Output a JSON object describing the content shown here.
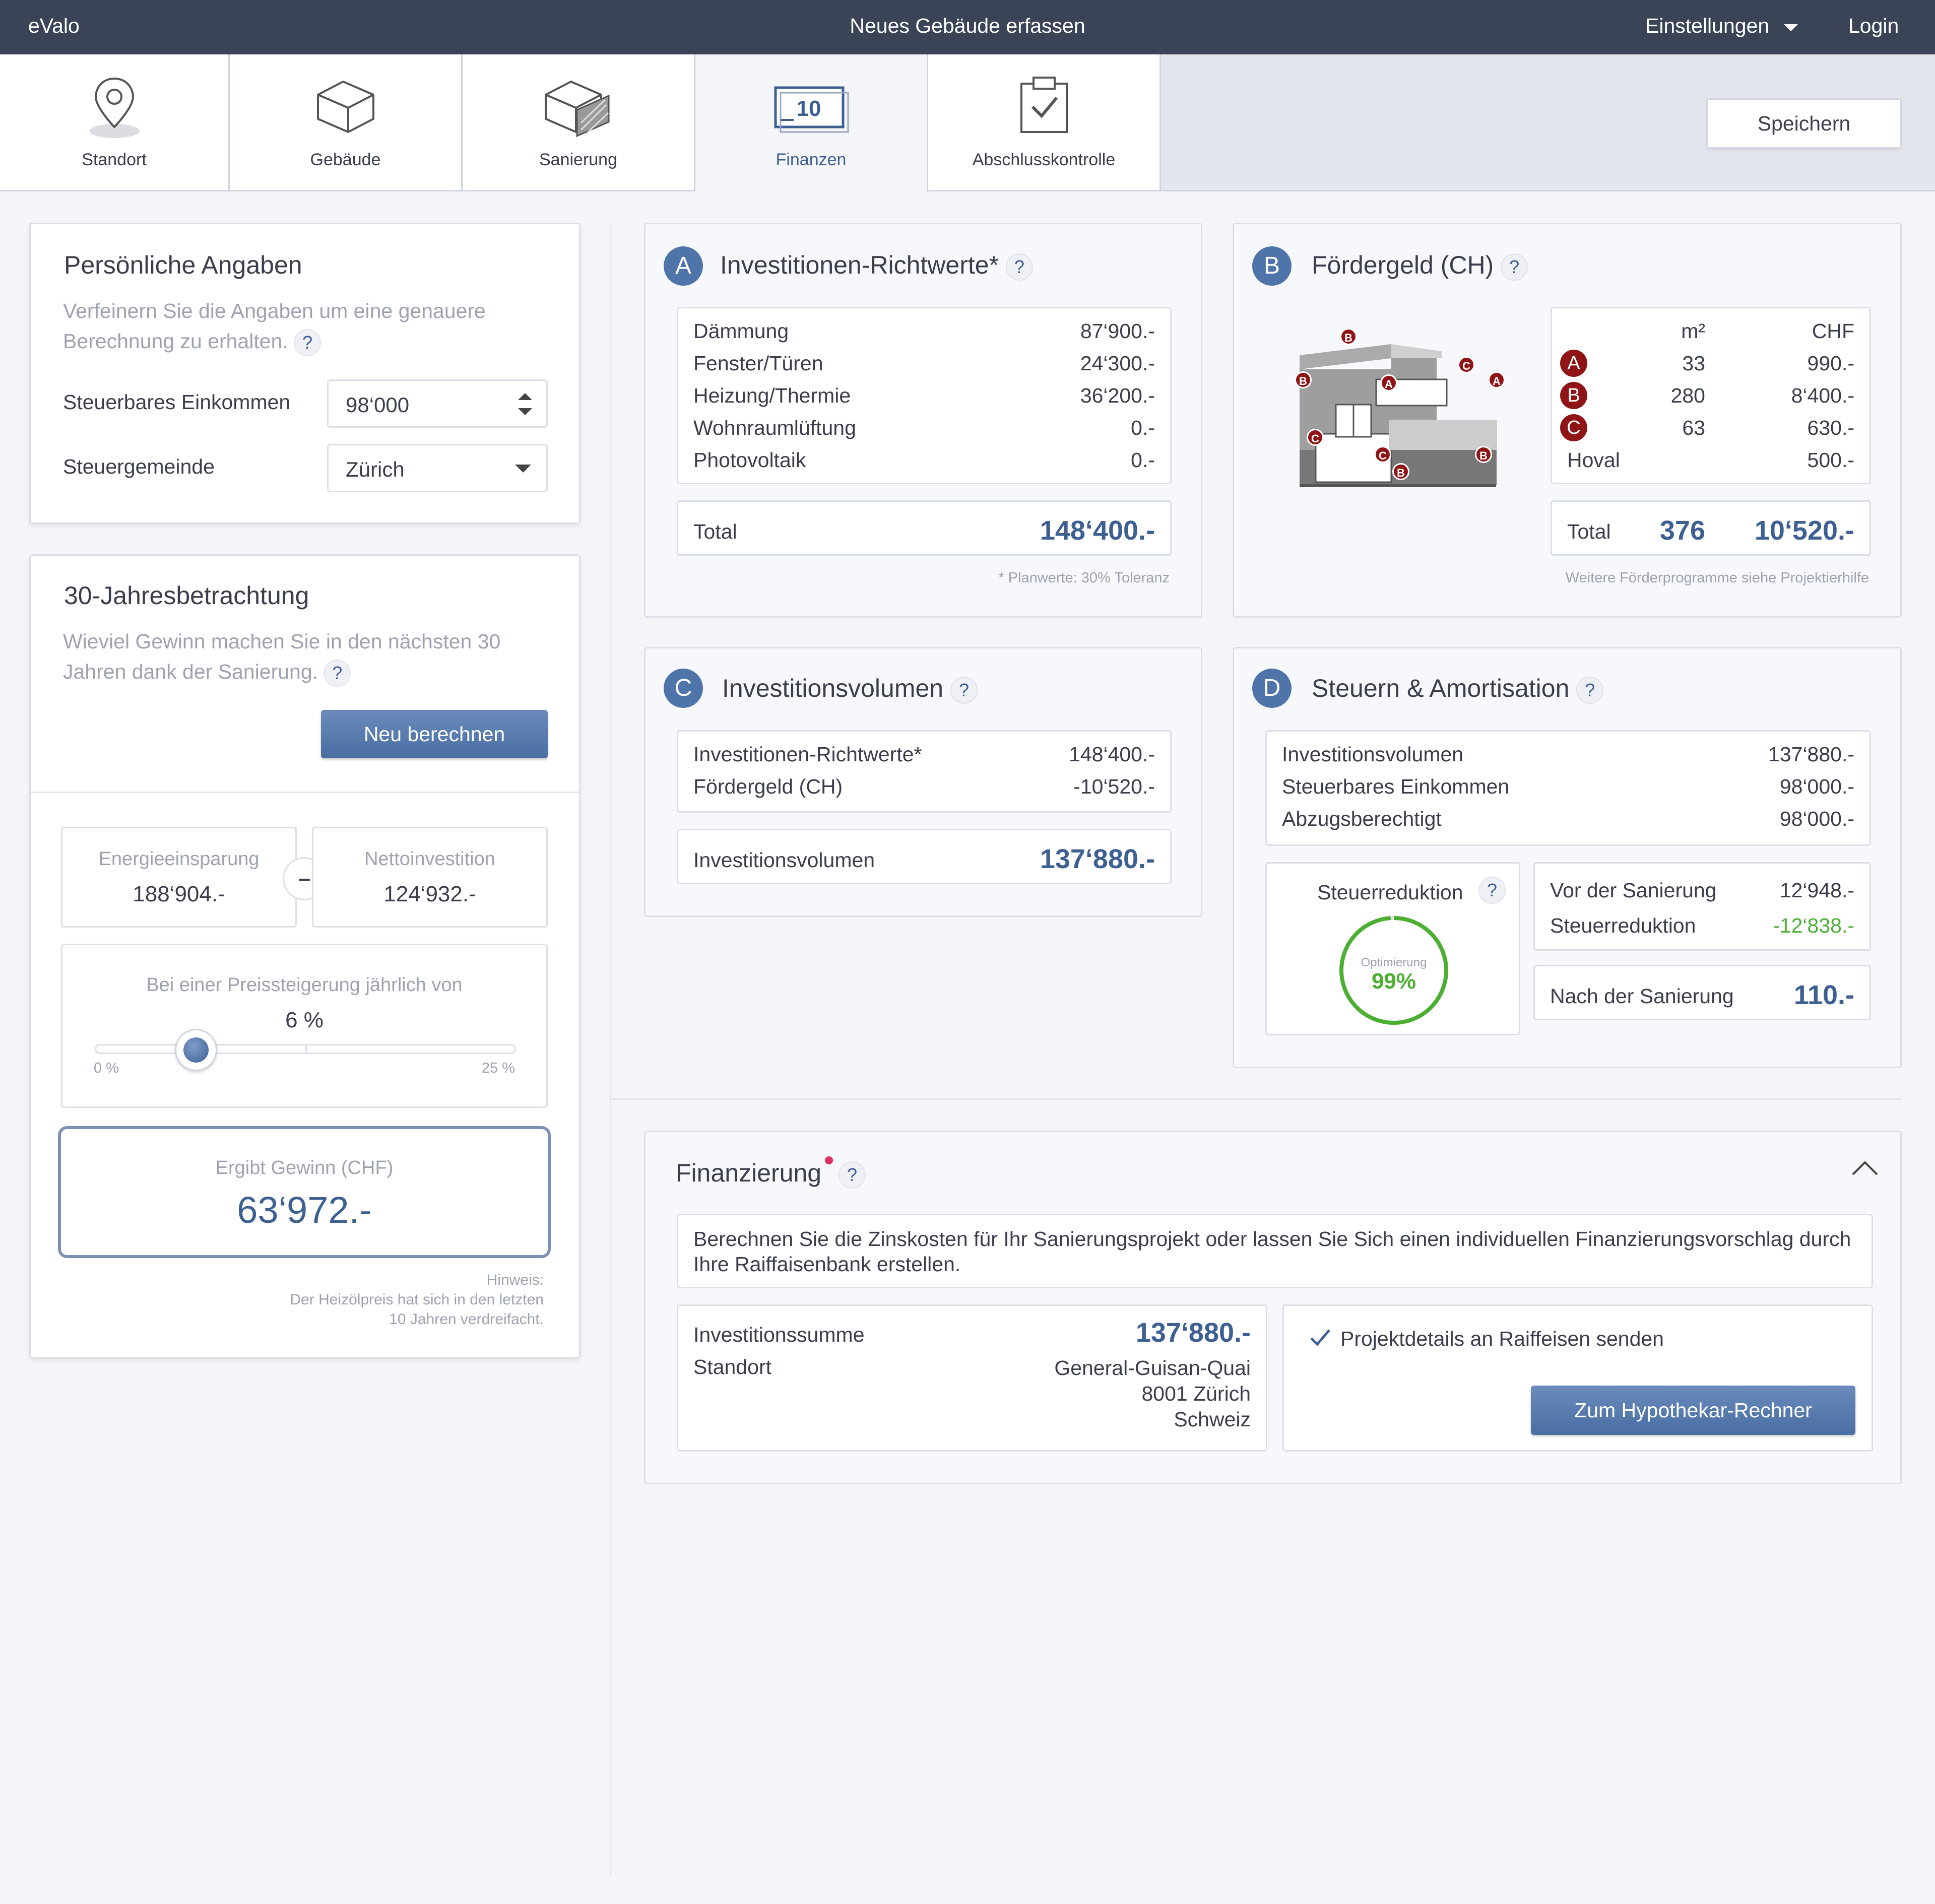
{
  "app": {
    "brand": "eValo",
    "title": "Neues Gebäude erfassen",
    "settings": "Einstellungen",
    "login": "Login",
    "save": "Speichern"
  },
  "tabs": [
    "Standort",
    "Gebäude",
    "Sanierung",
    "Finanzen",
    "Abschlusskontrolle"
  ],
  "finanzen_icon_number": "10",
  "personal": {
    "title": "Persönliche Angaben",
    "hint": "Verfeinern Sie die Angaben um eine genauere Berechnung zu erhalten.",
    "income_label": "Steuerbares Einkommen",
    "income_value": "98‘000",
    "community_label": "Steuergemeinde",
    "community_value": "Zürich"
  },
  "thirty": {
    "title": "30-Jahresbetrachtung",
    "hint": "Wieviel Gewinn machen Sie in den nächsten 30 Jahren dank der Sanierung.",
    "recalc": "Neu berechnen",
    "energy_label": "Energieeinsparung",
    "energy_value": "188‘904.-",
    "minus": "–",
    "net_label": "Nettoinvestition",
    "net_value": "124‘932.-",
    "slider_label": "Bei einer Preissteigerung jährlich von",
    "slider_value": "6 %",
    "slider_fraction": 0.24,
    "slider_min": "0 %",
    "slider_max": "25 %",
    "result_label": "Ergibt Gewinn (CHF)",
    "result_value": "63‘972.-",
    "note1": "Hinweis:",
    "note2": "Der Heizölpreis hat sich in den letzten",
    "note3": "10 Jahren verdreifacht."
  },
  "sectionA": {
    "badge": "A",
    "title": "Investitionen-Richtwerte*",
    "items": [
      {
        "label": "Dämmung",
        "value": "87‘900.-"
      },
      {
        "label": "Fenster/Türen",
        "value": "24‘300.-"
      },
      {
        "label": "Heizung/Thermie",
        "value": "36‘200.-"
      },
      {
        "label": "Wohnraumlüftung",
        "value": "0.-"
      },
      {
        "label": "Photovoltaik",
        "value": "0.-"
      }
    ],
    "total_label": "Total",
    "total_value": "148‘400.-",
    "footnote": "* Planwerte: 30% Toleranz"
  },
  "sectionB": {
    "badge": "B",
    "title": "Fördergeld (CH)",
    "col_m2": "m²",
    "col_chf": "CHF",
    "rows": [
      {
        "key": "A",
        "m2": "33",
        "chf": "990.-"
      },
      {
        "key": "B",
        "m2": "280",
        "chf": "8‘400.-"
      },
      {
        "key": "C",
        "m2": "63",
        "chf": "630.-"
      }
    ],
    "hoval_label": "Hoval",
    "hoval_chf": "500.-",
    "total_label": "Total",
    "total_m2": "376",
    "total_chf": "10‘520.-",
    "footnote": "Weitere Förderprogramme siehe Projektierhilfe"
  },
  "sectionC": {
    "badge": "C",
    "title": "Investitionsvolumen",
    "items": [
      {
        "label": "Investitionen-Richtwerte*",
        "value": "148‘400.-"
      },
      {
        "label": "Fördergeld (CH)",
        "value": "-10‘520.-"
      }
    ],
    "total_label": "Investitionsvolumen",
    "total_value": "137‘880.-"
  },
  "sectionD": {
    "badge": "D",
    "title": "Steuern & Amortisation",
    "items": [
      {
        "label": "Investitionsvolumen",
        "value": "137‘880.-"
      },
      {
        "label": "Steuerbares Einkommen",
        "value": "98‘000.-"
      },
      {
        "label": "Abzugsberechtigt",
        "value": "98‘000.-"
      }
    ],
    "reduction_title": "Steuerreduktion",
    "gauge_label": "Optimierung",
    "gauge_value": "99%",
    "gauge_fraction": 0.99,
    "before_label": "Vor der Sanierung",
    "before_value": "12‘948.-",
    "red_label": "Steuerreduktion",
    "red_value": "-12‘838.-",
    "after_label": "Nach der Sanierung",
    "after_value": "110.-"
  },
  "financing": {
    "title": "Finanzierung",
    "text": "Berechnen Sie die Zinskosten für Ihr Sanierungsprojekt oder lassen Sie Sich einen individuellen Finanzierungsvorschlag durch Ihre Raiffaisenbank erstellen.",
    "sum_label": "Investitionssumme",
    "sum_value": "137‘880.-",
    "loc_label": "Standort",
    "loc1": "General-Guisan-Quai",
    "loc2": "8001 Zürich",
    "loc3": "Schweiz",
    "check_label": "Projektdetails an Raiffeisen senden",
    "button": "Zum Hypothekar-Rechner"
  },
  "colors": {
    "accent": "#3d5f92",
    "header": "#3b4356",
    "green": "#4caf32",
    "marker": "#8f1416"
  }
}
